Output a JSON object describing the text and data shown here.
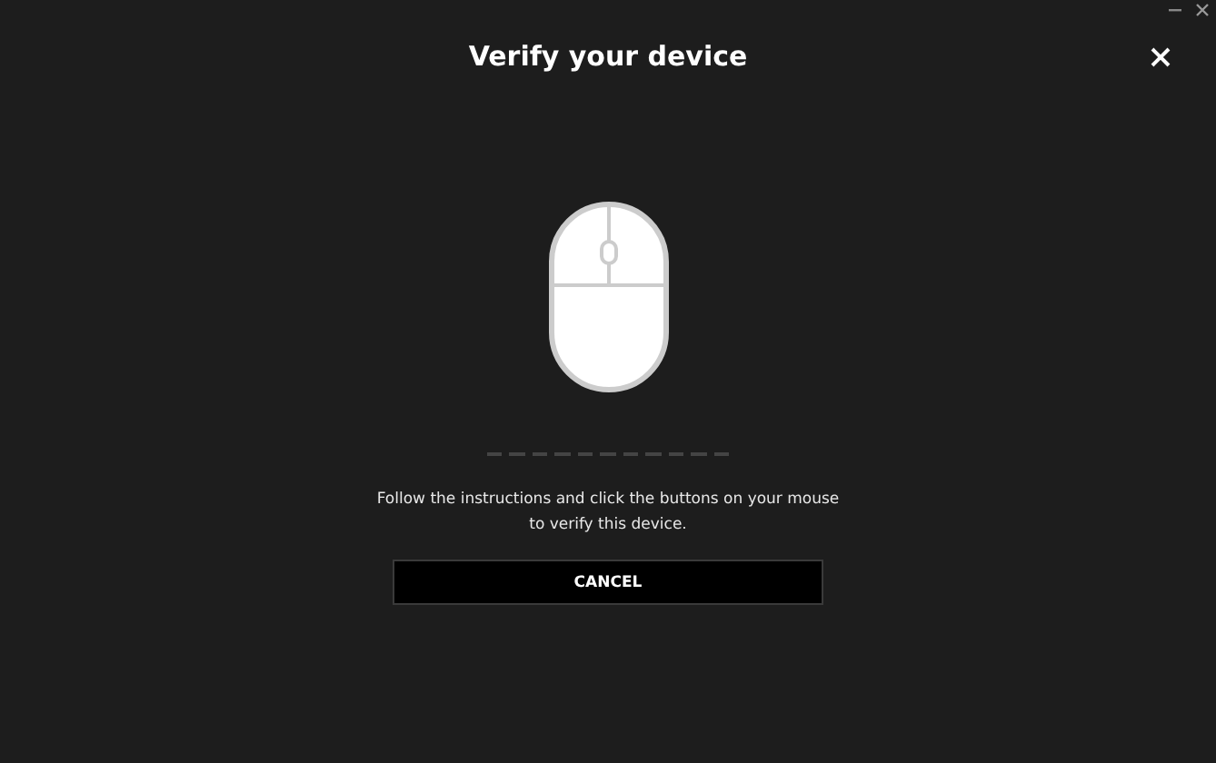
{
  "dialog": {
    "title": "Verify your device"
  },
  "progress": {
    "steps": [
      {
        "done": false
      },
      {
        "done": false
      },
      {
        "done": false
      },
      {
        "done": false
      },
      {
        "done": false
      },
      {
        "done": false
      },
      {
        "done": false
      },
      {
        "done": false
      },
      {
        "done": false
      },
      {
        "done": false
      },
      {
        "done": false
      }
    ]
  },
  "instructions": [
    "Follow the instructions and click the buttons on your mouse",
    "to verify this device."
  ],
  "buttons": [
    {
      "label": "CANCEL"
    }
  ]
}
